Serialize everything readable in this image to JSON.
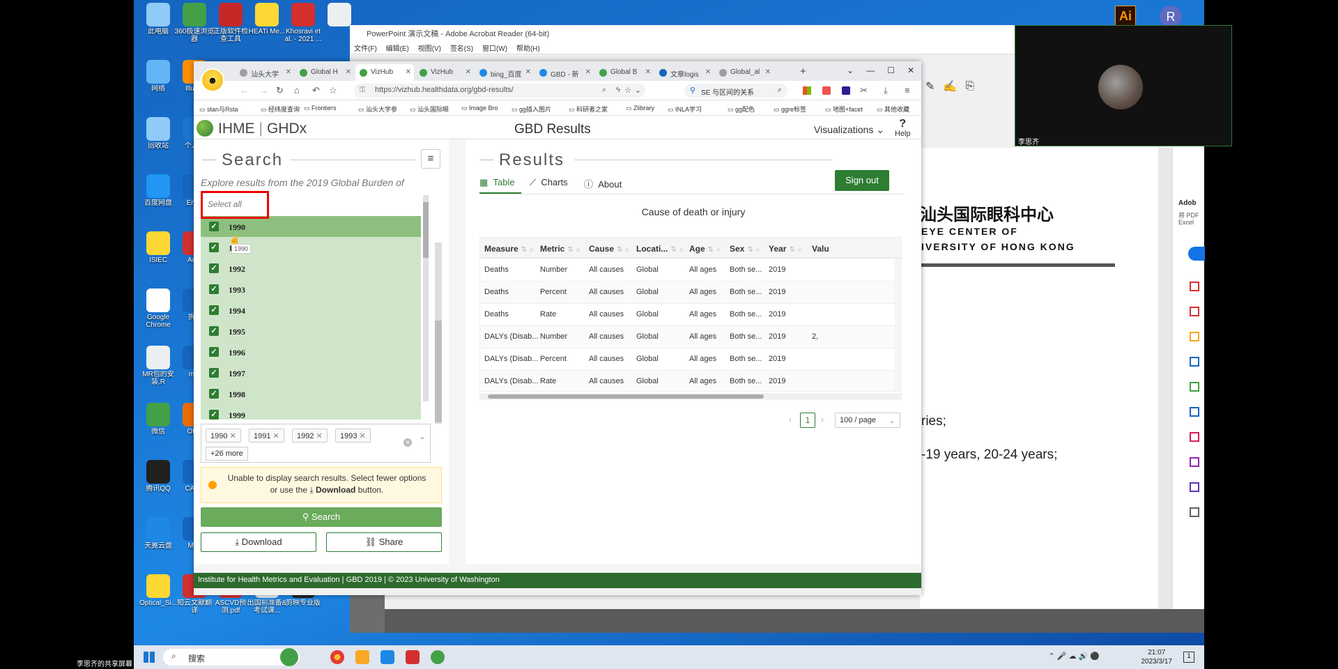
{
  "sharer_label": "李思齐的共享屏幕",
  "desktop_icons": [
    {
      "label": "此电脑",
      "icon": "computer-icon",
      "color": "#90caf9"
    },
    {
      "label": "360极速浏览器",
      "icon": "browser-icon",
      "color": "#43a047"
    },
    {
      "label": "正版软件检查工具",
      "icon": "shield-icon",
      "color": "#c62828"
    },
    {
      "label": "HEATi Me...",
      "icon": "folder-icon",
      "color": "#fdd835"
    },
    {
      "label": "Khosravi et al. - 2021 ...",
      "icon": "pdf-icon",
      "color": "#d32f2f"
    },
    {
      "label": "",
      "icon": "file-icon",
      "color": "#eceff1"
    },
    {
      "label": "网络",
      "icon": "network-icon",
      "color": "#64b5f6"
    },
    {
      "label": "Illus...",
      "icon": "illustrator-icon",
      "color": "#ff8f00"
    },
    {
      "label": "回收站",
      "icon": "recycle-bin-icon",
      "color": "#90caf9"
    },
    {
      "label": "个人...",
      "icon": "user-icon",
      "color": "#1976d2"
    },
    {
      "label": "百度网盘",
      "icon": "cloud-icon",
      "color": "#2196f3"
    },
    {
      "label": "Eni...",
      "icon": "app-icon",
      "color": "#1565c0"
    },
    {
      "label": "ISIEC",
      "icon": "folder-icon",
      "color": "#fdd835"
    },
    {
      "label": "Ac...",
      "icon": "acrobat-icon",
      "color": "#d32f2f"
    },
    {
      "label": "Google Chrome",
      "icon": "chrome-icon",
      "color": "#ffffff"
    },
    {
      "label": "拆...",
      "icon": "app-icon",
      "color": "#1565c0"
    },
    {
      "label": "MR包的安装.R",
      "icon": "file-icon",
      "color": "#eceff1"
    },
    {
      "label": "m...",
      "icon": "app-icon",
      "color": "#1565c0"
    },
    {
      "label": "微信",
      "icon": "wechat-icon",
      "color": "#43a047"
    },
    {
      "label": "OF...",
      "icon": "app-icon",
      "color": "#ef6c00"
    },
    {
      "label": "腾讯QQ",
      "icon": "qq-icon",
      "color": "#212121"
    },
    {
      "label": "CAJ...",
      "icon": "app-icon",
      "color": "#1565c0"
    },
    {
      "label": "天翼云盘",
      "icon": "cloud-icon",
      "color": "#1e88e5"
    },
    {
      "label": "Mi...",
      "icon": "app-icon",
      "color": "#1565c0"
    },
    {
      "label": "Optical_Si...",
      "icon": "file-icon",
      "color": "#fdd835"
    },
    {
      "label": "知云文献翻译",
      "icon": "translate-icon",
      "color": "#d32f2f"
    },
    {
      "label": "ASCVD预测.pdf",
      "icon": "pdf-icon",
      "color": "#d32f2f"
    },
    {
      "label": "出国前准备&考试课...",
      "icon": "file-icon",
      "color": "#eceff1"
    },
    {
      "label": "剪映专业版",
      "icon": "video-icon",
      "color": "#212121"
    }
  ],
  "acrobat": {
    "title": "PowerPoint 演示文稿 - Adobe Acrobat Reader (64-bit)",
    "menu": [
      "文件(F)",
      "编辑(E)",
      "视图(V)",
      "签名(S)",
      "窗口(W)",
      "帮助(H)"
    ],
    "doc_cn": "汕头国际眼科中心",
    "doc_en1": "EYE CENTER  OF",
    "doc_en2": "IVERSITY OF HONG KONG",
    "doc_line1": "ries;",
    "doc_line2": "-19 years, 20-24 years;",
    "right_label1": "Adob",
    "right_label2": "将 PDF",
    "right_label3": "Excel"
  },
  "webcam": {
    "name": "李思齐"
  },
  "browser": {
    "tabs": [
      {
        "label": "汕头大学",
        "color": "#9e9e9e"
      },
      {
        "label": "Global H",
        "color": "#43a047"
      },
      {
        "label": "VizHub",
        "color": "#43a047",
        "active": true
      },
      {
        "label": "VizHub",
        "color": "#43a047"
      },
      {
        "label": "bing_百度",
        "color": "#1e88e5"
      },
      {
        "label": "GBD - 新",
        "color": "#1e88e5"
      },
      {
        "label": "Global B",
        "color": "#43a047"
      },
      {
        "label": "文章logis",
        "color": "#1565c0"
      },
      {
        "label": "Global_al",
        "color": "#9e9e9e"
      }
    ],
    "url": "https://vizhub.healthdata.org/gbd-results/",
    "search_text": "SE 与区间的关系",
    "bookmarks": [
      "stan与Rsta",
      "经纬度查询",
      "Frontiers",
      "汕头大学参",
      "汕头国际眼",
      "Image Bro",
      "gg插入图片",
      "科研者之家",
      "Zlibrary",
      "INLA学习",
      "gg配色",
      "ggre标签",
      "地图+facet",
      "其他收藏"
    ]
  },
  "header": {
    "brand_left": "IHME",
    "brand_right": "GHDx",
    "title": "GBD Results",
    "visualizations": "Visualizations",
    "help": "Help"
  },
  "search_panel": {
    "heading": "Search",
    "explore_text": "Explore results from the 2019 Global Burden of",
    "select_all": "Select all",
    "years": [
      "1990",
      "1991",
      "1992",
      "1993",
      "1994",
      "1995",
      "1996",
      "1997",
      "1998",
      "1999"
    ],
    "tooltip": "1990",
    "selected_tags": [
      "1990",
      "1991",
      "1992",
      "1993"
    ],
    "more_tag": "+26 more",
    "warning_line1": "Unable to display search results. Select fewer options",
    "warning_line2_pre": "or use the",
    "warning_bold": "Download",
    "warning_line2_post": "button.",
    "search_button": "Search",
    "download_button": "Download",
    "share_button": "Share"
  },
  "results_panel": {
    "heading": "Results",
    "tabs": [
      "Table",
      "Charts",
      "About"
    ],
    "sign_out": "Sign out",
    "table_title": "Cause of death or injury",
    "columns": [
      "Measure",
      "Metric",
      "Cause",
      "Locati...",
      "Age",
      "Sex",
      "Year",
      "Valu"
    ],
    "rows": [
      [
        "Deaths",
        "Number",
        "All causes",
        "Global",
        "All ages",
        "Both se...",
        "2019",
        ""
      ],
      [
        "Deaths",
        "Percent",
        "All causes",
        "Global",
        "All ages",
        "Both se...",
        "2019",
        ""
      ],
      [
        "Deaths",
        "Rate",
        "All causes",
        "Global",
        "All ages",
        "Both se...",
        "2019",
        ""
      ],
      [
        "DALYs (Disab...",
        "Number",
        "All causes",
        "Global",
        "All ages",
        "Both se...",
        "2019",
        "2,"
      ],
      [
        "DALYs (Disab...",
        "Percent",
        "All causes",
        "Global",
        "All ages",
        "Both se...",
        "2019",
        ""
      ],
      [
        "DALYs (Disab...",
        "Rate",
        "All causes",
        "Global",
        "All ages",
        "Both se...",
        "2019",
        ""
      ]
    ],
    "page": "1",
    "page_size": "100 / page"
  },
  "footer": "Institute for Health Metrics and Evaluation  |  GBD 2019  |  © 2023 University of Washington",
  "taskbar": {
    "search_placeholder": "搜索",
    "time": "21:07",
    "date": "2023/3/17"
  }
}
